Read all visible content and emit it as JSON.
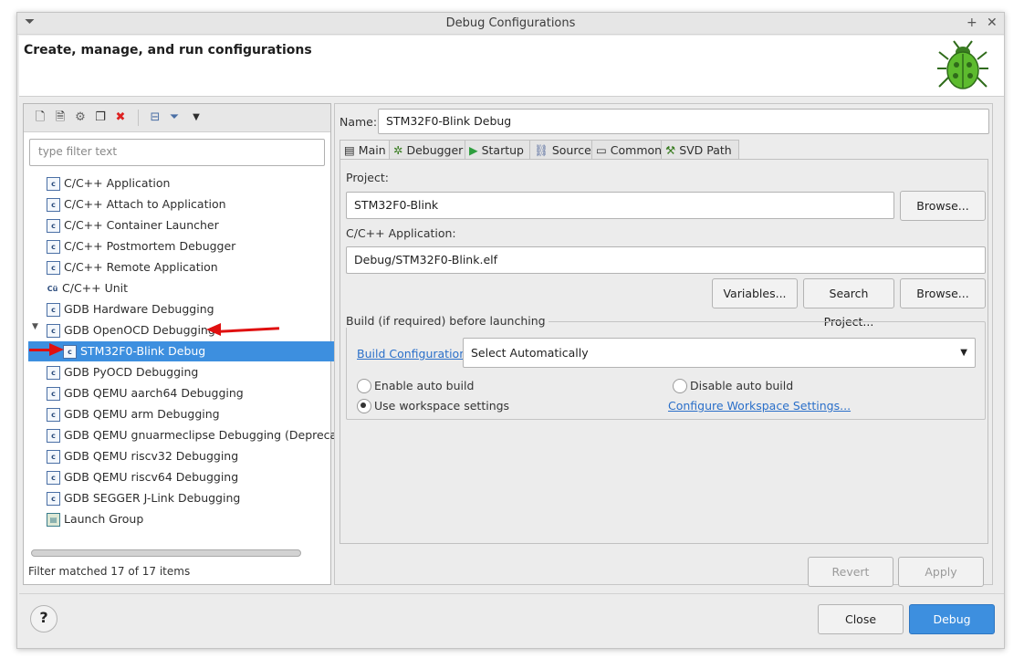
{
  "window": {
    "title": "Debug Configurations",
    "header_title": "Create, manage, and run configurations",
    "header_icon": "bug-icon"
  },
  "left": {
    "filter_placeholder": "type filter text",
    "status": "Filter matched 17 of 17 items",
    "tree": [
      {
        "label": "C/C++ Application",
        "icon": "c-config-icon"
      },
      {
        "label": "C/C++ Attach to Application",
        "icon": "c-config-icon"
      },
      {
        "label": "C/C++ Container Launcher",
        "icon": "c-config-icon"
      },
      {
        "label": "C/C++ Postmortem Debugger",
        "icon": "c-config-icon"
      },
      {
        "label": "C/C++ Remote Application",
        "icon": "c-config-icon"
      },
      {
        "label": "C/C++ Unit",
        "icon": "c-unit-icon"
      },
      {
        "label": "GDB Hardware Debugging",
        "icon": "c-config-icon"
      },
      {
        "label": "GDB OpenOCD Debugging",
        "icon": "c-config-icon",
        "expanded": true
      },
      {
        "label": "STM32F0-Blink Debug",
        "icon": "c-config-icon",
        "selected": true,
        "child": true
      },
      {
        "label": "GDB PyOCD Debugging",
        "icon": "c-config-icon"
      },
      {
        "label": "GDB QEMU aarch64 Debugging",
        "icon": "c-config-icon"
      },
      {
        "label": "GDB QEMU arm Debugging",
        "icon": "c-config-icon"
      },
      {
        "label": "GDB QEMU gnuarmeclipse Debugging (Deprecated",
        "icon": "c-config-icon"
      },
      {
        "label": "GDB QEMU riscv32 Debugging",
        "icon": "c-config-icon"
      },
      {
        "label": "GDB QEMU riscv64 Debugging",
        "icon": "c-config-icon"
      },
      {
        "label": "GDB SEGGER J-Link Debugging",
        "icon": "c-config-icon"
      },
      {
        "label": "Launch Group",
        "icon": "launch-group-icon"
      }
    ]
  },
  "right": {
    "name_label": "Name:",
    "name_value": "STM32F0-Blink Debug",
    "tabs": [
      "Main",
      "Debugger",
      "Startup",
      "Source",
      "Common",
      "SVD Path"
    ],
    "project_label": "Project:",
    "project_value": "STM32F0-Blink",
    "browse_label": "Browse...",
    "app_label": "C/C++ Application:",
    "app_value": "Debug/STM32F0-Blink.elf",
    "variables_label": "Variables...",
    "search_project_label": "Search Project...",
    "build_group_label": "Build (if required) before launching",
    "build_config_link": "Build Configuration:",
    "build_config_value": "Select Automatically",
    "enable_auto_build": "Enable auto build",
    "disable_auto_build": "Disable auto build",
    "use_workspace": "Use workspace settings",
    "configure_workspace_link": "Configure Workspace Settings...",
    "revert_label": "Revert",
    "apply_label": "Apply"
  },
  "footer": {
    "close_label": "Close",
    "debug_label": "Debug",
    "help_label": "?"
  },
  "colors": {
    "accent": "#3d8fdf",
    "annotation_arrow": "#e01010"
  }
}
